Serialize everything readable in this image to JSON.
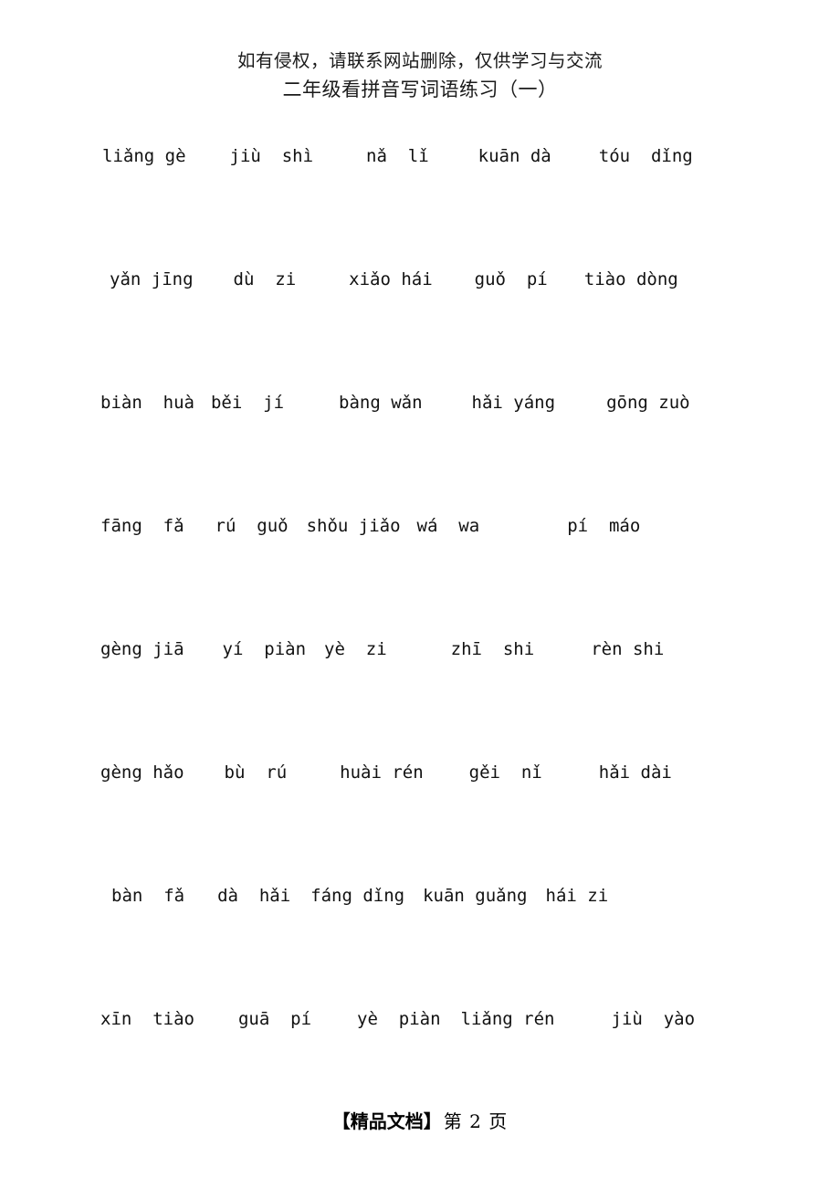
{
  "header": {
    "notice": "如有侵权，请联系网站删除，仅供学习与交流",
    "title": "二年级看拼音写词语练习（一）"
  },
  "footer": {
    "doc_label": "【精品文档】",
    "page_label": "第 2 页"
  },
  "exercise": {
    "rows": [
      {
        "indent": 112,
        "items": [
          {
            "text": "liǎng gè",
            "gap": 48
          },
          {
            "text": "jiù  shì",
            "gap": 58
          },
          {
            "text": "nǎ  lǐ",
            "gap": 54
          },
          {
            "text": "kuān dà",
            "gap": 52
          },
          {
            "text": "tóu  dǐng",
            "gap": 0
          }
        ]
      },
      {
        "indent": 120,
        "items": [
          {
            "text": "yǎn jīng",
            "gap": 44
          },
          {
            "text": "dù  zi",
            "gap": 58
          },
          {
            "text": "xiǎo hái",
            "gap": 46
          },
          {
            "text": "guǒ  pí",
            "gap": 40
          },
          {
            "text": "tiào dòng",
            "gap": 0
          }
        ]
      },
      {
        "indent": 110,
        "items": [
          {
            "text": "biàn  huà",
            "gap": 18
          },
          {
            "text": "běi  jí",
            "gap": 60
          },
          {
            "text": "bàng wǎn",
            "gap": 54
          },
          {
            "text": "hǎi yáng",
            "gap": 56
          },
          {
            "text": "gōng zuò",
            "gap": 0
          }
        ]
      },
      {
        "indent": 110,
        "items": [
          {
            "text": "fāng  fǎ",
            "gap": 34
          },
          {
            "text": "rú  guǒ",
            "gap": 20
          },
          {
            "text": "shǒu jiǎo",
            "gap": 18
          },
          {
            "text": "wá  wa",
            "gap": 96
          },
          {
            "text": "pí  máo",
            "gap": 0
          }
        ]
      },
      {
        "indent": 110,
        "items": [
          {
            "text": "gèng jiā",
            "gap": 42
          },
          {
            "text": "yí  piàn",
            "gap": 20
          },
          {
            "text": "yè  zi",
            "gap": 70
          },
          {
            "text": "zhī  shi",
            "gap": 62
          },
          {
            "text": "rèn shi",
            "gap": 0
          }
        ]
      },
      {
        "indent": 110,
        "items": [
          {
            "text": "gèng hǎo",
            "gap": 44
          },
          {
            "text": "bù  rú",
            "gap": 58
          },
          {
            "text": "huài rén",
            "gap": 50
          },
          {
            "text": "gěi  nǐ",
            "gap": 62
          },
          {
            "text": "hǎi dài",
            "gap": 0
          }
        ]
      },
      {
        "indent": 122,
        "items": [
          {
            "text": "bàn  fǎ",
            "gap": 36
          },
          {
            "text": "dà  hǎi",
            "gap": 22
          },
          {
            "text": "fáng dǐng",
            "gap": 20
          },
          {
            "text": "kuān guǎng",
            "gap": 20
          },
          {
            "text": "hái zi",
            "gap": 0
          }
        ]
      },
      {
        "indent": 110,
        "items": [
          {
            "text": "xīn  tiào",
            "gap": 48
          },
          {
            "text": "guā  pí",
            "gap": 50
          },
          {
            "text": "yè  piàn",
            "gap": 22
          },
          {
            "text": "liǎng rén",
            "gap": 62
          },
          {
            "text": "jiù  yào",
            "gap": 0
          }
        ]
      }
    ]
  }
}
